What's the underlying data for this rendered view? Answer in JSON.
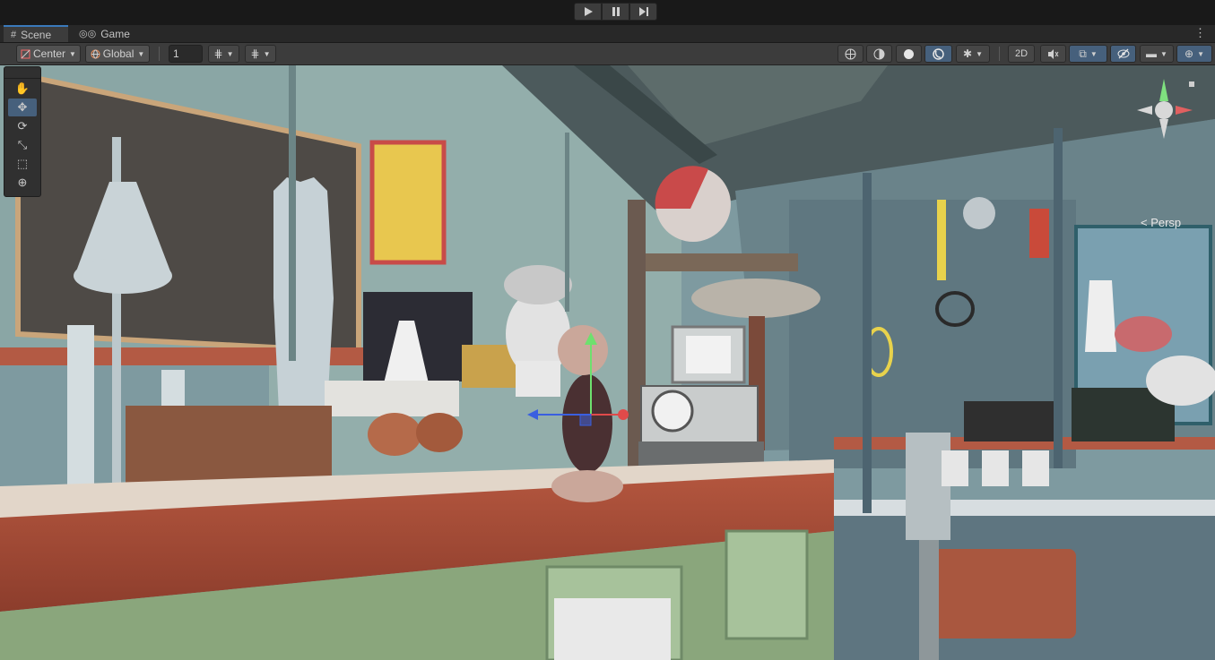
{
  "playbar": {
    "buttons": [
      {
        "name": "play-button",
        "glyph": "▶"
      },
      {
        "name": "pause-button",
        "glyph": "❚❚"
      },
      {
        "name": "step-button",
        "glyph": "▶❙"
      }
    ]
  },
  "tabs": {
    "scene": {
      "label": "Scene",
      "glyph": "#"
    },
    "game": {
      "label": "Game",
      "glyph": "◎◎"
    },
    "more": "⋮"
  },
  "toolbar": {
    "pivot_label": "Center",
    "space_label": "Global",
    "grid_size_value": "1",
    "mode_2d": "2D"
  },
  "palette": {
    "tools": [
      {
        "name": "hand-tool",
        "glyph": "✋"
      },
      {
        "name": "move-tool",
        "glyph": "✥"
      },
      {
        "name": "rotate-tool",
        "glyph": "⟳"
      },
      {
        "name": "scale-tool",
        "glyph": "⤡"
      },
      {
        "name": "rect-tool",
        "glyph": "⬚"
      },
      {
        "name": "transform-tool",
        "glyph": "⊕"
      }
    ]
  },
  "gizmo": {
    "projection_label": "< Persp"
  },
  "colors": {
    "accent": "#3a79bb",
    "active_button": "#46607c",
    "toolbar_bg": "#3c3c3c"
  }
}
